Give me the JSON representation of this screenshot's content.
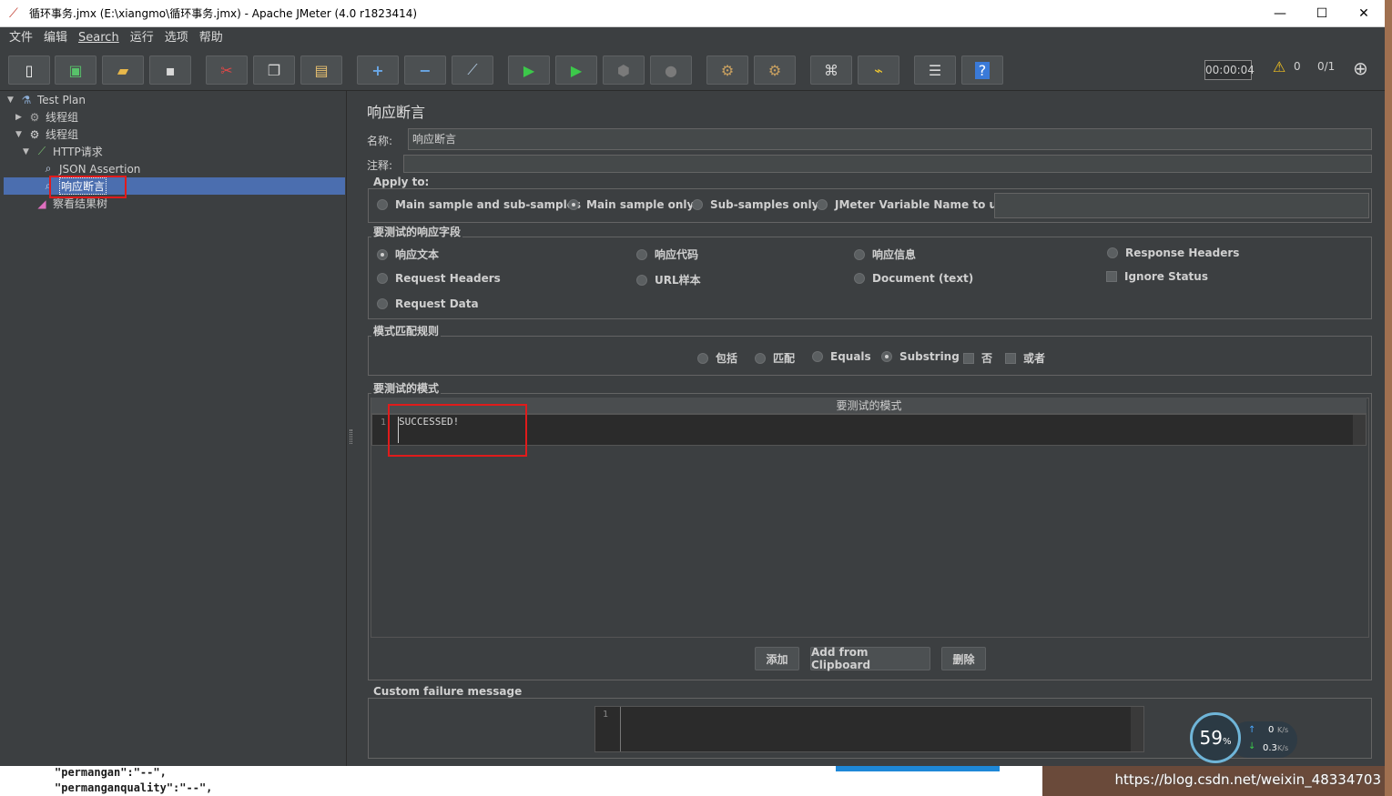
{
  "window": {
    "title": "循环事务.jmx (E:\\xiangmo\\循环事务.jmx) - Apache JMeter (4.0 r1823414)",
    "min": "—",
    "max": "☐",
    "close": "✕"
  },
  "menu": [
    "文件",
    "编辑",
    "Search",
    "运行",
    "选项",
    "帮助"
  ],
  "toolbar": {
    "timer": "00:00:04",
    "warn_count": "0",
    "threads": "0/1"
  },
  "tree": {
    "items": [
      {
        "label": "Test Plan"
      },
      {
        "label": "线程组"
      },
      {
        "label": "线程组"
      },
      {
        "label": "HTTP请求"
      },
      {
        "label": "JSON Assertion"
      },
      {
        "label": "响应断言"
      },
      {
        "label": "察看结果树"
      }
    ]
  },
  "panel": {
    "title": "响应断言",
    "name_label": "名称:",
    "name_value": "响应断言",
    "comment_label": "注释:",
    "apply_to": {
      "title": "Apply to:",
      "options": [
        "Main sample and sub-samples",
        "Main sample only",
        "Sub-samples only",
        "JMeter Variable Name to use"
      ],
      "selected": "Main sample only"
    },
    "field": {
      "title": "要测试的响应字段",
      "options": [
        "响应文本",
        "响应代码",
        "响应信息",
        "Response Headers",
        "Request Headers",
        "URL样本",
        "Document (text)",
        "Request Data"
      ],
      "ignore_status": "Ignore Status",
      "selected": "响应文本"
    },
    "pattern_rules": {
      "title": "模式匹配规则",
      "options": [
        "包括",
        "匹配",
        "Equals",
        "Substring"
      ],
      "not_label": "否",
      "or_label": "或者",
      "selected": "Substring"
    },
    "patterns": {
      "title": "要测试的模式",
      "column": "要测试的模式",
      "line_no": "1",
      "value": "SUCCESSED!"
    },
    "buttons": {
      "add": "添加",
      "clipboard": "Add from Clipboard",
      "delete": "删除"
    },
    "failure": {
      "title": "Custom failure message",
      "line_no": "1"
    }
  },
  "background": {
    "json1": "\"permangan\":\"--\",",
    "json2": "\"permanganquality\":\"--\",",
    "watermark": "https://blog.csdn.net/weixin_48334703"
  },
  "net": {
    "percent": "59",
    "percent_unit": "%",
    "up": "0",
    "down": "0.3",
    "unit": "K/s"
  }
}
